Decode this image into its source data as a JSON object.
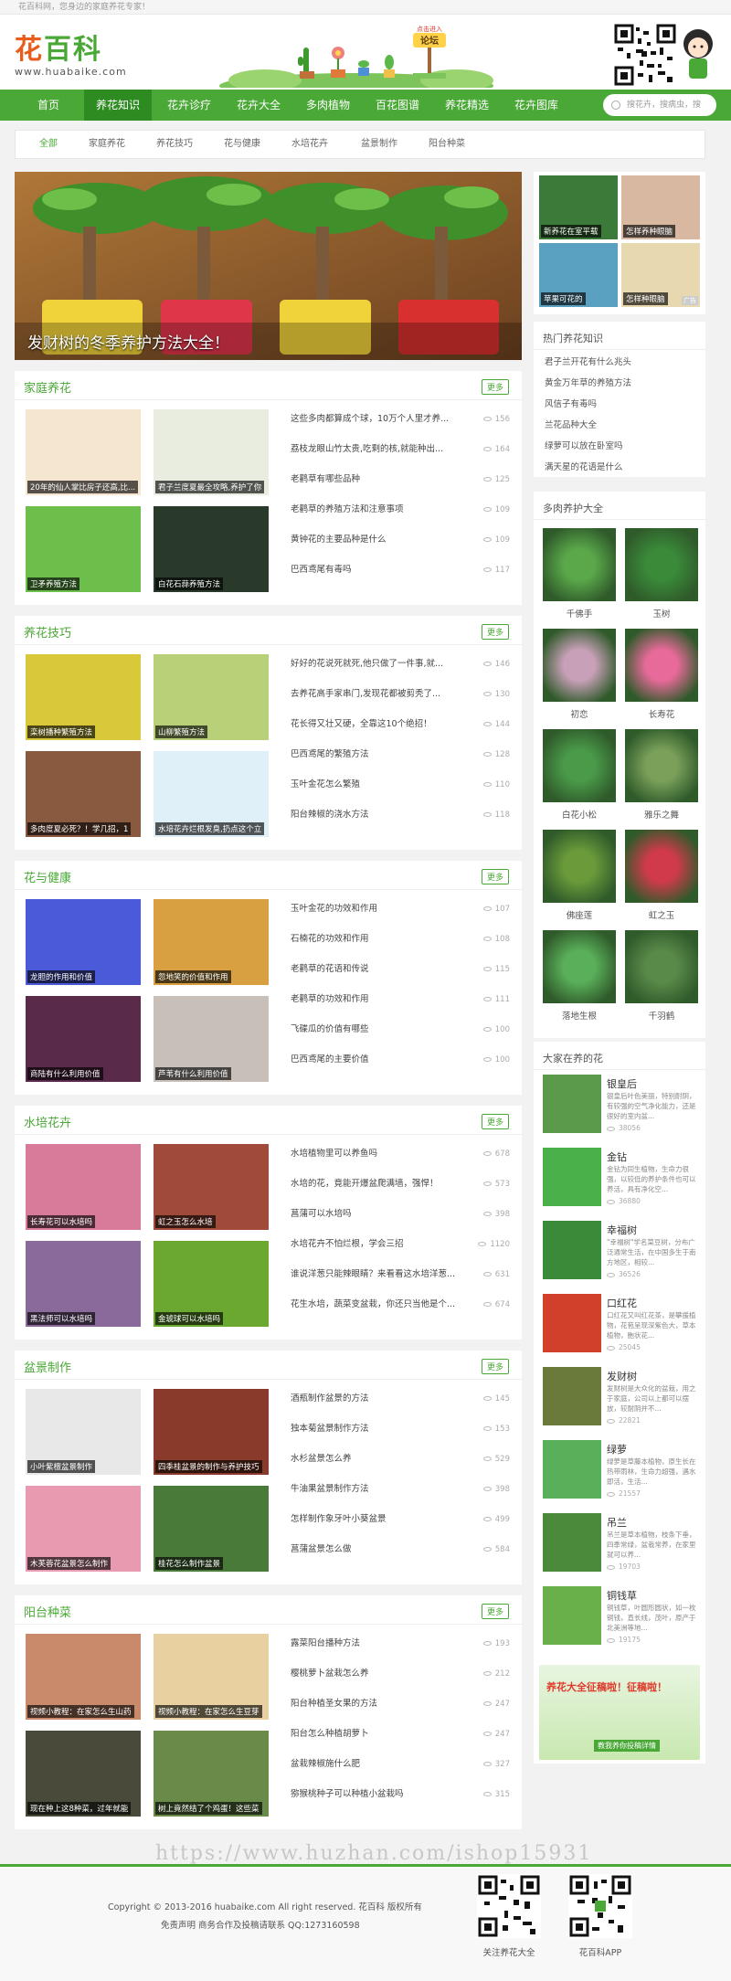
{
  "topbar": {
    "text": "花百科网，您身边的家庭养花专家！"
  },
  "header": {
    "logo_cn_a": "花",
    "logo_cn_b": "百科",
    "logo_url": "www.huabaike.com",
    "forum_tag": "点击进入",
    "forum_label": "论坛"
  },
  "nav": {
    "items": [
      "首页",
      "养花知识",
      "花卉诊疗",
      "花卉大全",
      "多肉植物",
      "百花图谱",
      "养花精选",
      "花卉图库"
    ],
    "active_index": 1,
    "search_placeholder": "搜花卉，搜病虫，搜"
  },
  "subnav": {
    "items": [
      "全部",
      "家庭养花",
      "养花技巧",
      "花与健康",
      "水培花卉",
      "盆景制作",
      "阳台种菜"
    ]
  },
  "hero": {
    "caption": "发财树的冬季养护方法大全！"
  },
  "sections": [
    {
      "title": "家庭养花",
      "more": "更多",
      "thumbs": [
        "20年的仙人掌比房子还高,比...",
        "君子兰度夏最全攻略,养护了你",
        "卫矛养殖方法",
        "白花石蒜养殖方法"
      ],
      "items": [
        {
          "t": "这些多肉都算成个球，10万个人里才养...",
          "v": "156"
        },
        {
          "t": "荔枝龙眼山竹太贵,吃剩的核,就能种出...",
          "v": "164"
        },
        {
          "t": "老鹳草有哪些品种",
          "v": "125"
        },
        {
          "t": "老鹳草的养殖方法和注意事项",
          "v": "109"
        },
        {
          "t": "黄钟花的主要品种是什么",
          "v": "109"
        },
        {
          "t": "巴西鸢尾有毒吗",
          "v": "117"
        }
      ]
    },
    {
      "title": "养花技巧",
      "more": "更多",
      "thumbs": [
        "栾树播种繁殖方法",
        "山柳繁殖方法",
        "多肉度夏必死？！学几招，1",
        "水培花卉烂根发臭,扔点这个立"
      ],
      "items": [
        {
          "t": "好好的花说死就死,他只做了一件事,就...",
          "v": "146"
        },
        {
          "t": "去养花高手家串门,发现花都被剪秃了...",
          "v": "130"
        },
        {
          "t": "花长得又壮又硬，全靠这10个绝招！",
          "v": "144"
        },
        {
          "t": "巴西鸢尾的繁殖方法",
          "v": "128"
        },
        {
          "t": "玉叶金花怎么繁殖",
          "v": "110"
        },
        {
          "t": "阳台辣椒的浇水方法",
          "v": "118"
        }
      ]
    },
    {
      "title": "花与健康",
      "more": "更多",
      "thumbs": [
        "龙胆的作用和价值",
        "忽地笑的价值和作用",
        "商陆有什么利用价值",
        "芦苇有什么利用价值"
      ],
      "items": [
        {
          "t": "玉叶金花的功效和作用",
          "v": "107"
        },
        {
          "t": "石楠花的功效和作用",
          "v": "108"
        },
        {
          "t": "老鹳草的花语和传说",
          "v": "115"
        },
        {
          "t": "老鹳草的功效和作用",
          "v": "111"
        },
        {
          "t": "飞碟瓜的价值有哪些",
          "v": "100"
        },
        {
          "t": "巴西鸢尾的主要价值",
          "v": "100"
        }
      ]
    },
    {
      "title": "水培花卉",
      "more": "更多",
      "thumbs": [
        "长寿花可以水培吗",
        "虹之玉怎么水培",
        "黑法师可以水培吗",
        "金琥球可以水培吗"
      ],
      "items": [
        {
          "t": "水培植物里可以养鱼吗",
          "v": "678"
        },
        {
          "t": "水培的花，竟能开爆盆爬满墙，强悍！",
          "v": "573"
        },
        {
          "t": "菖蒲可以水培吗",
          "v": "398"
        },
        {
          "t": "水培花卉不怕烂根，学会三招",
          "v": "1120"
        },
        {
          "t": "谁说洋葱只能辣眼睛？来看看这水培洋葱...",
          "v": "631"
        },
        {
          "t": "花生水培，蔬菜变盆栽，你还只当他是个...",
          "v": "674"
        }
      ]
    },
    {
      "title": "盆景制作",
      "more": "更多",
      "thumbs": [
        "小叶紫檀盆景制作",
        "四季桂盆景的制作与养护技巧",
        "木芙蓉花盆景怎么制作",
        "桂花怎么制作盆景"
      ],
      "items": [
        {
          "t": "酒瓶制作盆景的方法",
          "v": "145"
        },
        {
          "t": "独本菊盆景制作方法",
          "v": "153"
        },
        {
          "t": "水杉盆景怎么养",
          "v": "529"
        },
        {
          "t": "牛油果盆景制作方法",
          "v": "398"
        },
        {
          "t": "怎样制作象牙叶小葵盆景",
          "v": "499"
        },
        {
          "t": "菖蒲盆景怎么做",
          "v": "584"
        }
      ]
    },
    {
      "title": "阳台种菜",
      "more": "更多",
      "thumbs": [
        "视频小教程：在家怎么生山药",
        "视频小教程：在家怎么生豆芽",
        "现在种上这8种菜，过年就能",
        "树上竟然结了个鸡蛋！这些菜"
      ],
      "items": [
        {
          "t": "露菜阳台播种方法",
          "v": "193"
        },
        {
          "t": "樱桃萝卜盆栽怎么养",
          "v": "212"
        },
        {
          "t": "阳台种植圣女果的方法",
          "v": "247"
        },
        {
          "t": "阳台怎么种植胡萝卜",
          "v": "247"
        },
        {
          "t": "盆栽辣椒施什么肥",
          "v": "327"
        },
        {
          "t": "猕猴桃种子可以种植小盆栽吗",
          "v": "315"
        }
      ]
    }
  ],
  "side_top": {
    "thumbs": [
      "新养花在室平载",
      "怎样养种眼脑",
      "苹果可花的",
      "怎样种眼脑"
    ],
    "badge": "广告"
  },
  "hot": {
    "title": "热门养花知识",
    "items": [
      "君子兰开花有什么兆头",
      "黄金万年草的养殖方法",
      "风信子有毒吗",
      "兰花品种大全",
      "绿萝可以放在卧室吗",
      "满天星的花语是什么"
    ]
  },
  "succulent": {
    "title": "多肉养护大全",
    "items": [
      "千佛手",
      "玉树",
      "初恋",
      "长寿花",
      "白花小松",
      "雅乐之舞",
      "佛座莲",
      "虹之玉",
      "落地生根",
      "千羽鹤"
    ]
  },
  "popular": {
    "title": "大家在养的花",
    "items": [
      {
        "name": "银皇后",
        "desc": "银皇后叶色美丽，特别耐阴，有较强的空气净化能力，还是很好的室内盆...",
        "count": "38056"
      },
      {
        "name": "金钻",
        "desc": "金钻为同生植物，生命力很强，以较低的养护条件也可以养活，具有净化空...",
        "count": "36880"
      },
      {
        "name": "幸福树",
        "desc": "\"幸福树\"学名菜豆树，分布广泛通常生活，在中国多生于南方地区，相较...",
        "count": "36526"
      },
      {
        "name": "口红花",
        "desc": "口红花又叫红花茶，是攀援植物，花苞呈现深紫色大，草本植物，胞状花...",
        "count": "25045"
      },
      {
        "name": "发财树",
        "desc": "发财树是大众化的盆栽，用之于家庭，公司以上都可以摆放，较耐阴并不...",
        "count": "22821"
      },
      {
        "name": "绿萝",
        "desc": "绿萝是草藤本植物，原生长在热带雨林，生命力超强，遇水即活，生活...",
        "count": "21557"
      },
      {
        "name": "吊兰",
        "desc": "吊兰是草本植物，枝条下垂，四季常绿，盆栽常养，在家里就可以养...",
        "count": "19703"
      },
      {
        "name": "铜钱草",
        "desc": "铜钱草，叶圆形圆状，如一枚铜钱，直长线，茂叶，原产于北美洲等地...",
        "count": "19175"
      }
    ]
  },
  "side_ad": {
    "top": "养花大全征稿啦！征稿啦！",
    "bottom": "教我养你投稿详情"
  },
  "watermark": "https://www.huzhan.com/ishop15931",
  "footer": {
    "line1": "Copyright © 2013-2016 huabaike.com All right reserved. 花百科 版权所有",
    "line2": "免责声明   商务合作及投稿请联系 QQ:1273160598",
    "qr1_label": "关注养花大全",
    "qr2_label": "花百科APP"
  },
  "colors": {
    "brand": "#4aa836",
    "nav_active": "#2e8b22"
  }
}
